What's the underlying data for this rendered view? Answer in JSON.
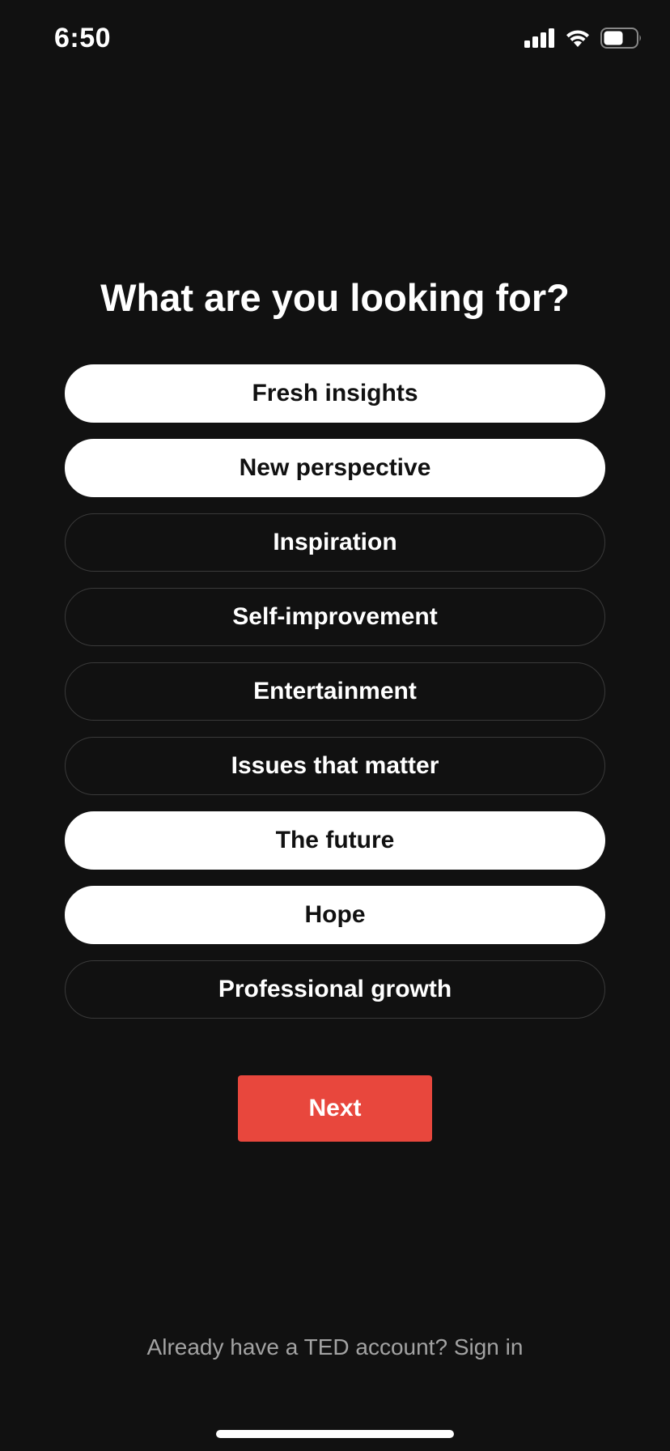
{
  "status_bar": {
    "time": "6:50",
    "icons": [
      "cellular-signal-icon",
      "wifi-icon",
      "battery-icon"
    ]
  },
  "title": "What are you looking for?",
  "options": [
    {
      "label": "Fresh insights",
      "selected": true
    },
    {
      "label": "New perspective",
      "selected": true
    },
    {
      "label": "Inspiration",
      "selected": false
    },
    {
      "label": "Self-improvement",
      "selected": false
    },
    {
      "label": "Entertainment",
      "selected": false
    },
    {
      "label": "Issues that matter",
      "selected": false
    },
    {
      "label": "The future",
      "selected": true
    },
    {
      "label": "Hope",
      "selected": true
    },
    {
      "label": "Professional growth",
      "selected": false
    }
  ],
  "next_label": "Next",
  "signin": {
    "prompt": "Already have a TED account?",
    "link": "Sign in"
  },
  "colors": {
    "background": "#111111",
    "accent": "#e8473d",
    "selected_fill": "#ffffff",
    "unselected_border": "#3a3a3a",
    "muted_text": "#a3a3a3"
  }
}
